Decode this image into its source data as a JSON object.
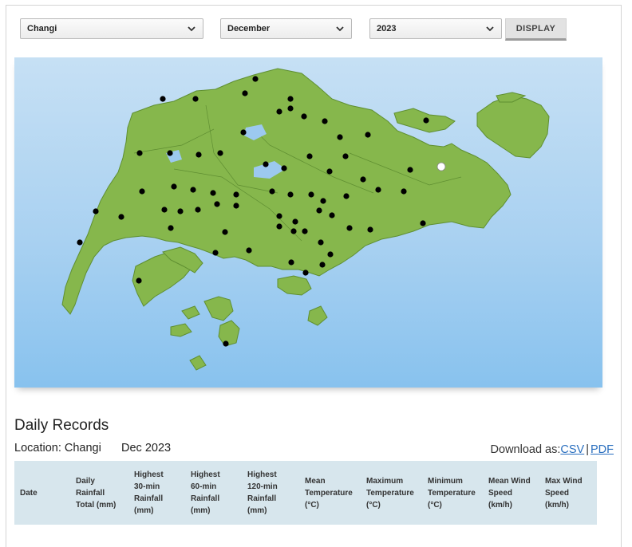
{
  "controls": {
    "station": {
      "selected": "Changi"
    },
    "month": {
      "selected": "December"
    },
    "year": {
      "selected": "2023"
    },
    "display_label": "DISPLAY"
  },
  "map": {
    "land_color": "#86b74c",
    "sea_color": "#a9d1f1",
    "selected_station": "Changi"
  },
  "records": {
    "title": "Daily Records",
    "location_text": "Location: Changi",
    "period_text": "Dec 2023",
    "download": {
      "label": "Download as:",
      "csv": "CSV",
      "separator": "|",
      "pdf": "PDF"
    },
    "columns": [
      "Date",
      "Daily Rainfall Total (mm)",
      "Highest 30-min Rainfall (mm)",
      "Highest 60-min Rainfall (mm)",
      "Highest 120-min Rainfall (mm)",
      "Mean Temperature (°C)",
      "Maximum Temperature (°C)",
      "Minimum Temperature (°C)",
      "Mean Wind Speed (km/h)",
      "Max Wind Speed (km/h)"
    ]
  }
}
